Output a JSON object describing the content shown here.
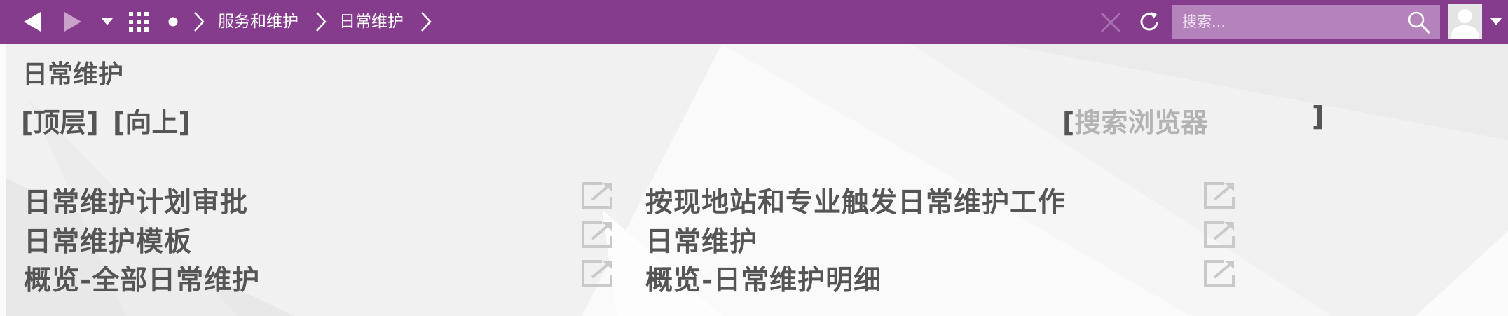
{
  "topbar": {
    "breadcrumbs": [
      "服务和维护",
      "日常维护"
    ],
    "search_placeholder": "搜索...",
    "colors": {
      "bar": "#863c8c",
      "search_bg": "#b583bb"
    },
    "icons": [
      "back-arrow-icon",
      "forward-arrow-icon",
      "dropdown-caret-icon",
      "app-grid-icon",
      "home-dot-icon",
      "chevron-right-icon",
      "close-icon",
      "refresh-icon",
      "search-icon",
      "user-avatar-icon"
    ]
  },
  "page": {
    "title": "日常维护",
    "nav_top": "[顶层]",
    "nav_up": "[向上]",
    "browser_search_open": "[",
    "browser_search_placeholder": "搜索浏览器",
    "browser_search_close": "]"
  },
  "items": {
    "left": [
      "日常维护计划审批",
      "日常维护模板",
      "概览-全部日常维护"
    ],
    "right": [
      "按现地站和专业触发日常维护工作",
      "日常维护",
      "概览-日常维护明细"
    ]
  }
}
